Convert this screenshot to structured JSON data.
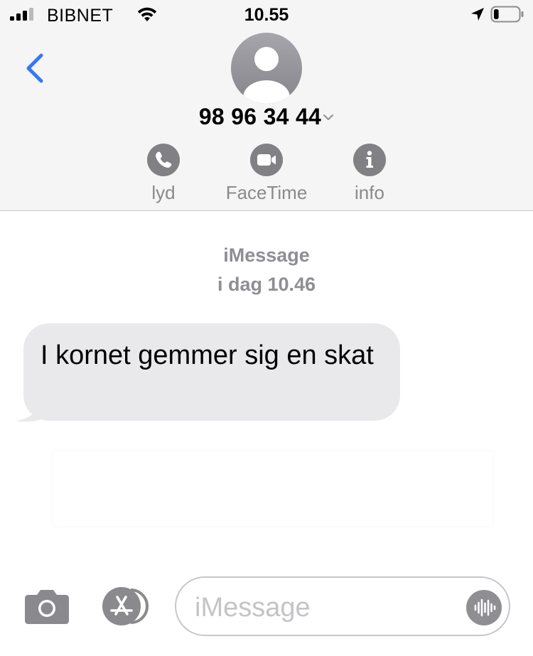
{
  "status_bar": {
    "carrier": "BIBNET",
    "time": "10.55",
    "signal_icon": "cellular-signal-icon",
    "wifi_icon": "wifi-icon",
    "location_icon": "location-arrow-icon",
    "battery_icon": "battery-icon",
    "battery_level": 0.2
  },
  "header": {
    "back_icon": "chevron-left-icon",
    "avatar_icon": "person-silhouette-icon",
    "contact_name": "98 96 34 44",
    "name_chevron_icon": "chevron-down-icon",
    "actions": [
      {
        "label": "lyd",
        "icon": "phone-icon"
      },
      {
        "label": "FaceTime",
        "icon": "video-camera-icon"
      },
      {
        "label": "info",
        "icon": "info-icon"
      }
    ]
  },
  "conversation": {
    "service": "iMessage",
    "timestamp": "i dag 10.46",
    "messages": [
      {
        "direction": "incoming",
        "text": "I kornet gemmer sig en skat"
      }
    ]
  },
  "input_bar": {
    "camera_icon": "camera-icon",
    "appstore_icon": "app-store-icon",
    "placeholder": "iMessage",
    "audio_icon": "audio-waveform-icon"
  },
  "colors": {
    "accent": "#3478f6",
    "header_bg": "#f5f5f5",
    "incoming_bubble": "#e9e9eb",
    "secondary_text": "#8e8e93",
    "icon_gray": "#808085"
  }
}
